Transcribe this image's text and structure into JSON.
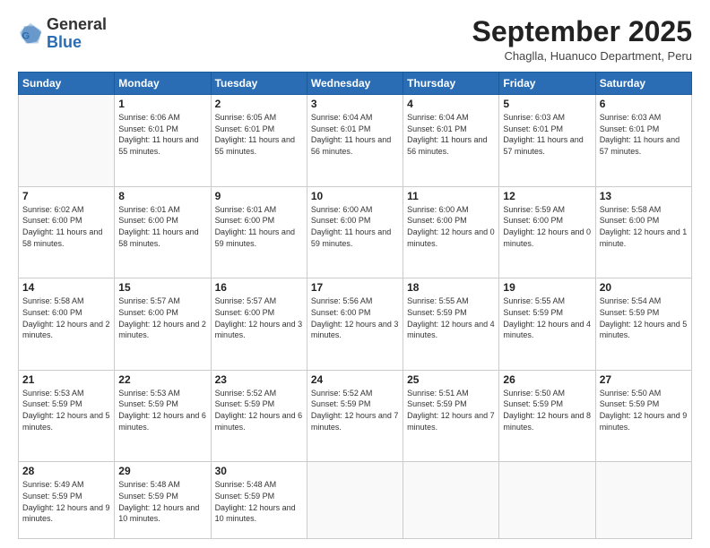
{
  "header": {
    "logo_general": "General",
    "logo_blue": "Blue",
    "month_title": "September 2025",
    "location": "Chaglla, Huanuco Department, Peru"
  },
  "days_of_week": [
    "Sunday",
    "Monday",
    "Tuesday",
    "Wednesday",
    "Thursday",
    "Friday",
    "Saturday"
  ],
  "weeks": [
    [
      {
        "day": "",
        "info": ""
      },
      {
        "day": "1",
        "info": "Sunrise: 6:06 AM\nSunset: 6:01 PM\nDaylight: 11 hours\nand 55 minutes."
      },
      {
        "day": "2",
        "info": "Sunrise: 6:05 AM\nSunset: 6:01 PM\nDaylight: 11 hours\nand 55 minutes."
      },
      {
        "day": "3",
        "info": "Sunrise: 6:04 AM\nSunset: 6:01 PM\nDaylight: 11 hours\nand 56 minutes."
      },
      {
        "day": "4",
        "info": "Sunrise: 6:04 AM\nSunset: 6:01 PM\nDaylight: 11 hours\nand 56 minutes."
      },
      {
        "day": "5",
        "info": "Sunrise: 6:03 AM\nSunset: 6:01 PM\nDaylight: 11 hours\nand 57 minutes."
      },
      {
        "day": "6",
        "info": "Sunrise: 6:03 AM\nSunset: 6:01 PM\nDaylight: 11 hours\nand 57 minutes."
      }
    ],
    [
      {
        "day": "7",
        "info": "Sunrise: 6:02 AM\nSunset: 6:00 PM\nDaylight: 11 hours\nand 58 minutes."
      },
      {
        "day": "8",
        "info": "Sunrise: 6:01 AM\nSunset: 6:00 PM\nDaylight: 11 hours\nand 58 minutes."
      },
      {
        "day": "9",
        "info": "Sunrise: 6:01 AM\nSunset: 6:00 PM\nDaylight: 11 hours\nand 59 minutes."
      },
      {
        "day": "10",
        "info": "Sunrise: 6:00 AM\nSunset: 6:00 PM\nDaylight: 11 hours\nand 59 minutes."
      },
      {
        "day": "11",
        "info": "Sunrise: 6:00 AM\nSunset: 6:00 PM\nDaylight: 12 hours\nand 0 minutes."
      },
      {
        "day": "12",
        "info": "Sunrise: 5:59 AM\nSunset: 6:00 PM\nDaylight: 12 hours\nand 0 minutes."
      },
      {
        "day": "13",
        "info": "Sunrise: 5:58 AM\nSunset: 6:00 PM\nDaylight: 12 hours\nand 1 minute."
      }
    ],
    [
      {
        "day": "14",
        "info": "Sunrise: 5:58 AM\nSunset: 6:00 PM\nDaylight: 12 hours\nand 2 minutes."
      },
      {
        "day": "15",
        "info": "Sunrise: 5:57 AM\nSunset: 6:00 PM\nDaylight: 12 hours\nand 2 minutes."
      },
      {
        "day": "16",
        "info": "Sunrise: 5:57 AM\nSunset: 6:00 PM\nDaylight: 12 hours\nand 3 minutes."
      },
      {
        "day": "17",
        "info": "Sunrise: 5:56 AM\nSunset: 6:00 PM\nDaylight: 12 hours\nand 3 minutes."
      },
      {
        "day": "18",
        "info": "Sunrise: 5:55 AM\nSunset: 5:59 PM\nDaylight: 12 hours\nand 4 minutes."
      },
      {
        "day": "19",
        "info": "Sunrise: 5:55 AM\nSunset: 5:59 PM\nDaylight: 12 hours\nand 4 minutes."
      },
      {
        "day": "20",
        "info": "Sunrise: 5:54 AM\nSunset: 5:59 PM\nDaylight: 12 hours\nand 5 minutes."
      }
    ],
    [
      {
        "day": "21",
        "info": "Sunrise: 5:53 AM\nSunset: 5:59 PM\nDaylight: 12 hours\nand 5 minutes."
      },
      {
        "day": "22",
        "info": "Sunrise: 5:53 AM\nSunset: 5:59 PM\nDaylight: 12 hours\nand 6 minutes."
      },
      {
        "day": "23",
        "info": "Sunrise: 5:52 AM\nSunset: 5:59 PM\nDaylight: 12 hours\nand 6 minutes."
      },
      {
        "day": "24",
        "info": "Sunrise: 5:52 AM\nSunset: 5:59 PM\nDaylight: 12 hours\nand 7 minutes."
      },
      {
        "day": "25",
        "info": "Sunrise: 5:51 AM\nSunset: 5:59 PM\nDaylight: 12 hours\nand 7 minutes."
      },
      {
        "day": "26",
        "info": "Sunrise: 5:50 AM\nSunset: 5:59 PM\nDaylight: 12 hours\nand 8 minutes."
      },
      {
        "day": "27",
        "info": "Sunrise: 5:50 AM\nSunset: 5:59 PM\nDaylight: 12 hours\nand 9 minutes."
      }
    ],
    [
      {
        "day": "28",
        "info": "Sunrise: 5:49 AM\nSunset: 5:59 PM\nDaylight: 12 hours\nand 9 minutes."
      },
      {
        "day": "29",
        "info": "Sunrise: 5:48 AM\nSunset: 5:59 PM\nDaylight: 12 hours\nand 10 minutes."
      },
      {
        "day": "30",
        "info": "Sunrise: 5:48 AM\nSunset: 5:59 PM\nDaylight: 12 hours\nand 10 minutes."
      },
      {
        "day": "",
        "info": ""
      },
      {
        "day": "",
        "info": ""
      },
      {
        "day": "",
        "info": ""
      },
      {
        "day": "",
        "info": ""
      }
    ]
  ]
}
